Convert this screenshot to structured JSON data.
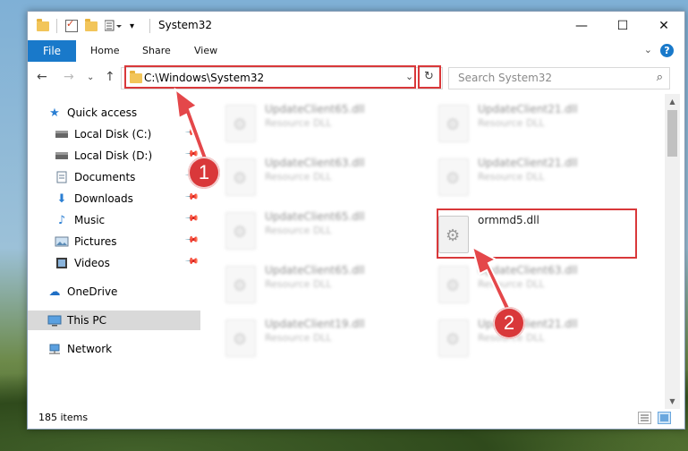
{
  "window": {
    "title": "System32",
    "controls": {
      "minimize": "—",
      "maximize": "☐",
      "close": "✕"
    }
  },
  "ribbon": {
    "file_tab": "File",
    "tabs": [
      "Home",
      "Share",
      "View"
    ],
    "help": "?"
  },
  "address": {
    "path": "C:\\Windows\\System32",
    "search_placeholder": "Search System32"
  },
  "sidebar": {
    "items": [
      {
        "label": "Quick access",
        "icon": "star-icon"
      },
      {
        "label": "Local Disk (C:)",
        "icon": "drive-icon"
      },
      {
        "label": "Local Disk (D:)",
        "icon": "drive-icon"
      },
      {
        "label": "Documents",
        "icon": "documents-icon"
      },
      {
        "label": "Downloads",
        "icon": "download-icon"
      },
      {
        "label": "Music",
        "icon": "music-icon"
      },
      {
        "label": "Pictures",
        "icon": "pictures-icon"
      },
      {
        "label": "Videos",
        "icon": "videos-icon"
      },
      {
        "label": "OneDrive",
        "icon": "cloud-icon"
      },
      {
        "label": "This PC",
        "icon": "pc-icon"
      },
      {
        "label": "Network",
        "icon": "network-icon"
      }
    ]
  },
  "files": {
    "type_label": "Resource DLL",
    "left_column": [
      "UpdateClient65.dll",
      "UpdateClient63.dll",
      "UpdateClient65.dll",
      "UpdateClient65.dll",
      "UpdateClient19.dll"
    ],
    "right_column": [
      "UpdateClient21.dll",
      "UpdateClient21.dll",
      "UpdateClient63.dll",
      "UpdateClient21.dll"
    ],
    "highlighted": "ormmd5.dll"
  },
  "status": {
    "item_count": "185 items"
  },
  "annotations": {
    "step1": "1",
    "step2": "2"
  },
  "colors": {
    "accent": "#1979ca",
    "highlight": "#d9383a",
    "selected_row": "#d9d9d9"
  }
}
